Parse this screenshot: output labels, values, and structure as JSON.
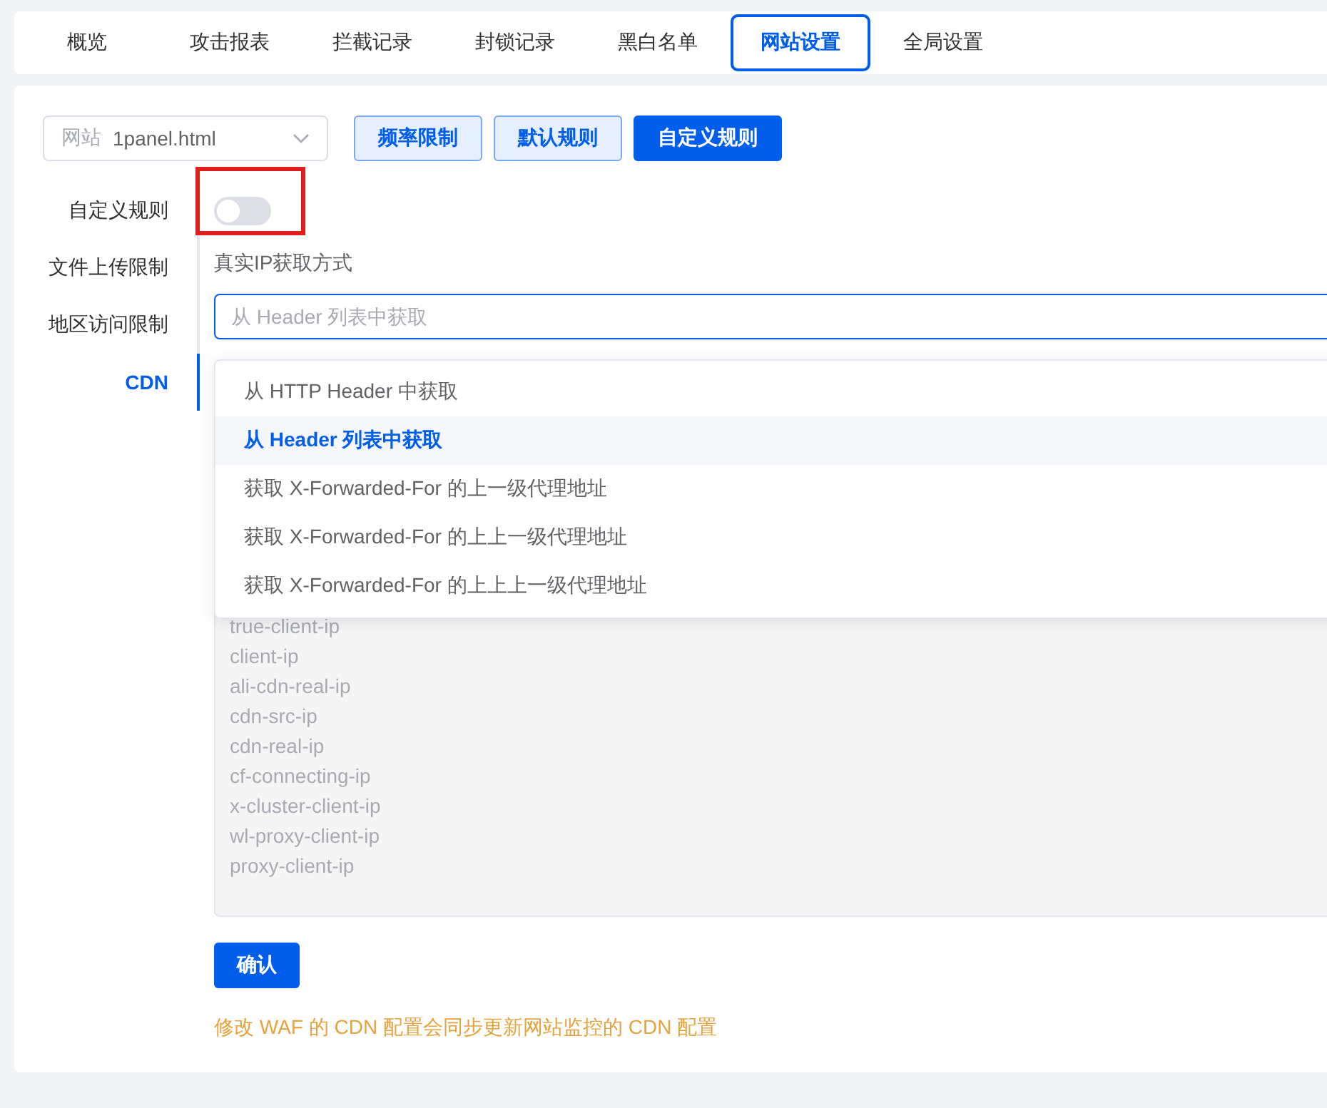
{
  "tabs": [
    {
      "label": "概览",
      "selected": false
    },
    {
      "label": "攻击报表",
      "selected": false
    },
    {
      "label": "拦截记录",
      "selected": false
    },
    {
      "label": "封锁记录",
      "selected": false
    },
    {
      "label": "黑白名单",
      "selected": false
    },
    {
      "label": "网站设置",
      "selected": true
    },
    {
      "label": "全局设置",
      "selected": false
    }
  ],
  "website_select": {
    "prefix": "网站",
    "value": "1panel.html"
  },
  "rule_buttons": [
    {
      "label": "频率限制",
      "selected": false
    },
    {
      "label": "默认规则",
      "selected": false
    },
    {
      "label": "自定义规则",
      "selected": true
    }
  ],
  "side_menu": [
    {
      "label": "自定义规则",
      "selected": false
    },
    {
      "label": "文件上传限制",
      "selected": false
    },
    {
      "label": "地区访问限制",
      "selected": false
    },
    {
      "label": "CDN",
      "selected": true
    }
  ],
  "toggle": {
    "on": false,
    "highlighted": true
  },
  "ip_source": {
    "label": "真实IP获取方式",
    "placeholder": "从 Header 列表中获取",
    "options": [
      {
        "label": "从 HTTP Header 中获取",
        "selected": false
      },
      {
        "label": "从 Header 列表中获取",
        "selected": true
      },
      {
        "label": "获取 X-Forwarded-For 的上一级代理地址",
        "selected": false
      },
      {
        "label": "获取 X-Forwarded-For 的上上一级代理地址",
        "selected": false
      },
      {
        "label": "获取 X-Forwarded-For 的上上上一级代理地址",
        "selected": false
      }
    ]
  },
  "header_list": [
    "true-client-ip",
    "client-ip",
    "ali-cdn-real-ip",
    "cdn-src-ip",
    "cdn-real-ip",
    "cf-connecting-ip",
    "x-cluster-client-ip",
    "wl-proxy-client-ip",
    "proxy-client-ip"
  ],
  "confirm_button": "确认",
  "notice": "修改 WAF 的 CDN 配置会同步更新网站监控的 CDN 配置"
}
